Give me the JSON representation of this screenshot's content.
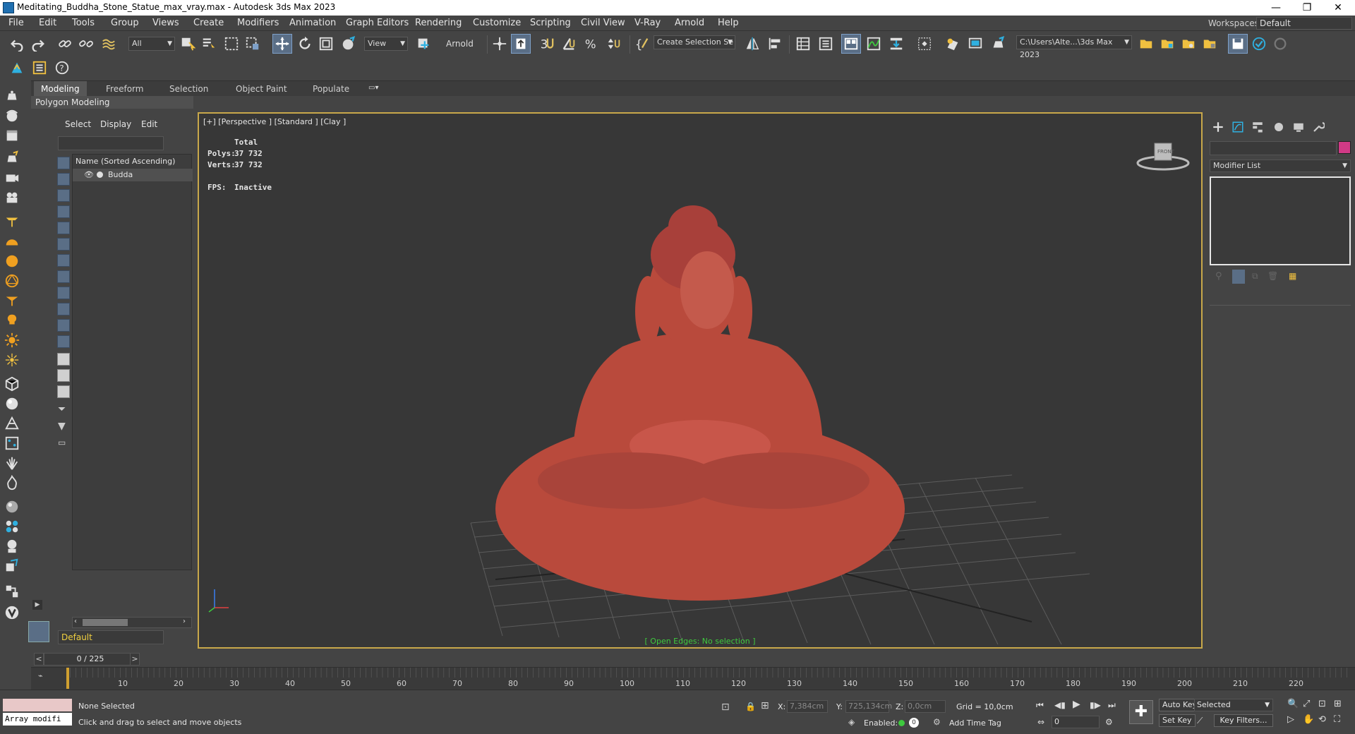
{
  "window": {
    "title": "Meditating_Buddha_Stone_Statue_max_vray.max - Autodesk 3ds Max 2023",
    "minimize": "—",
    "restore": "❐",
    "close": "✕"
  },
  "menu": {
    "items": [
      "File",
      "Edit",
      "Tools",
      "Group",
      "Views",
      "Create",
      "Modifiers",
      "Animation",
      "Graph Editors",
      "Rendering",
      "Customize",
      "Scripting",
      "Civil View",
      "V-Ray",
      "Arnold",
      "Help"
    ],
    "workspace_label": "Workspaces:",
    "workspace_value": "Default"
  },
  "toolbar": {
    "selection_filter": "All",
    "ref_coord": "View",
    "arnold_label": "Arnold",
    "named_selection": "Create Selection Se",
    "project_path": "C:\\Users\\Alte...\\3ds Max 2023"
  },
  "ribbon": {
    "tabs": [
      "Modeling",
      "Freeform",
      "Selection",
      "Object Paint",
      "Populate"
    ],
    "active": "Modeling",
    "subpanel": "Polygon Modeling"
  },
  "scene_explorer": {
    "tabs": [
      "Select",
      "Display",
      "Edit"
    ],
    "column_header": "Name (Sorted Ascending)",
    "object_name": "Budda",
    "layer": "Default"
  },
  "viewport": {
    "label": "[+] [Perspective ] [Standard ] [Clay ]",
    "stats": {
      "total_label": "Total",
      "polys_label": "Polys:",
      "polys_value": "37 732",
      "verts_label": "Verts:",
      "verts_value": "37 732",
      "fps_label": "FPS:",
      "fps_value": "Inactive"
    },
    "status": "[ Open Edges: No selection ]",
    "viewcube_label": "FRONT"
  },
  "command_panel": {
    "modifier_list": "Modifier List",
    "object_color": "#d03a86"
  },
  "timeline": {
    "slider": "0 / 225",
    "prev": "<",
    "next": ">",
    "ticks": [
      "10",
      "20",
      "30",
      "40",
      "50",
      "60",
      "70",
      "80",
      "90",
      "100",
      "110",
      "120",
      "130",
      "140",
      "150",
      "160",
      "170",
      "180",
      "190",
      "200",
      "210",
      "220"
    ]
  },
  "status": {
    "maxscript": "Array modifi",
    "selection": "None Selected",
    "prompt": "Click and drag to select and move objects",
    "x_label": "X:",
    "x_value": "7,384cm",
    "y_label": "Y:",
    "y_value": "725,134cm",
    "z_label": "Z:",
    "z_value": "0,0cm",
    "grid": "Grid = 10,0cm",
    "enabled_label": "Enabled:",
    "add_time_tag": "Add Time Tag",
    "auto_key": "Auto Key",
    "set_key": "Set Key",
    "selected": "Selected",
    "key_filters": "Key Filters...",
    "frame": "0"
  },
  "colors": {
    "accent": "#5a6e86",
    "viewport_border": "#c8a84a",
    "status_green": "#3ec93e",
    "statue": "#b94a3c"
  }
}
